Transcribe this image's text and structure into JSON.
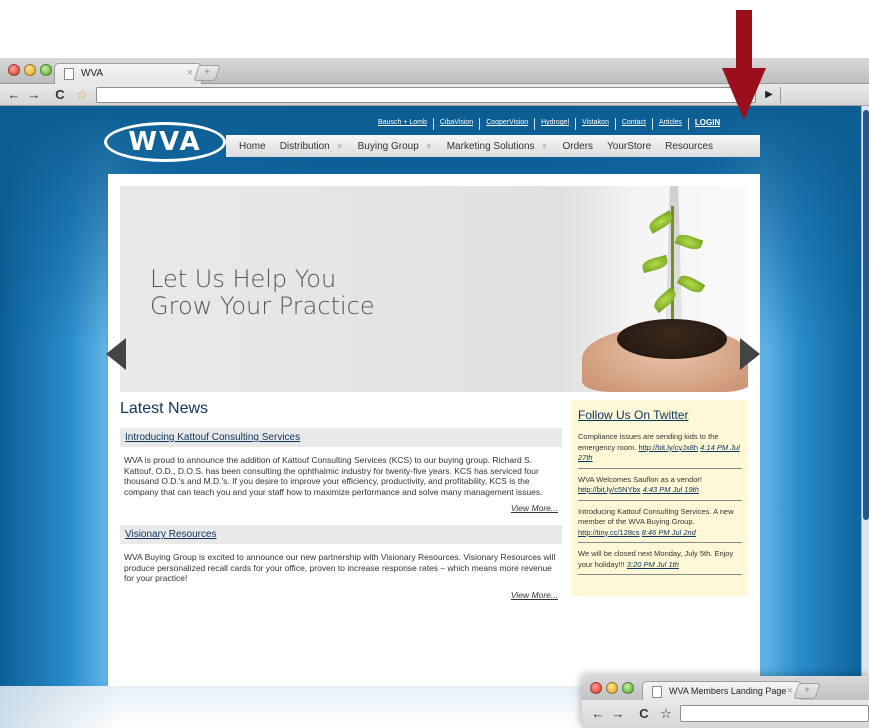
{
  "browser": {
    "tab_title": "WVA",
    "tab_close": "×",
    "new_tab": "+",
    "back": "←",
    "forward": "→",
    "reload": "C",
    "star": "☆",
    "play": "▶"
  },
  "site": {
    "logo_text": "WVA",
    "top_links": [
      "Bausch + Lomb",
      "CibaVision",
      "CooperVision",
      "Hydrogel",
      "Vistakon",
      "Contact",
      "Articles",
      "LOGIN"
    ],
    "nav": [
      {
        "label": "Home",
        "caret": ""
      },
      {
        "label": "Distribution",
        "caret": "▼"
      },
      {
        "label": "Buying Group",
        "caret": "▼"
      },
      {
        "label": "Marketing Solutions",
        "caret": "▼"
      },
      {
        "label": "Orders",
        "caret": ""
      },
      {
        "label": "YourStore",
        "caret": ""
      },
      {
        "label": "Resources",
        "caret": ""
      }
    ],
    "hero": {
      "line1": "Let Us Help You",
      "line2": "Grow Your Practice"
    },
    "news": {
      "heading": "Latest News",
      "articles": [
        {
          "title": "Introducing Kattouf Consulting Services",
          "body": "WVA is proud to announce the addition of Kattouf Consulting Services (KCS) to our buying group. Richard S. Kattouf, O.D., D.O.S. has been consulting the ophthalmic industry for twenty-five years. KCS has serviced four thousand O.D.'s and M.D.'s. If you desire to improve your efficiency, productivity, and profitability, KCS is the company that can teach you and your staff how to maximize performance and solve many management issues.",
          "more": "View More..."
        },
        {
          "title": "Visionary Resources",
          "body": "WVA Buying Group is excited to announce our new partnership with Visionary Resources. Visionary Resources will produce personalized recall cards for your office, proven to increase response rates – which means more revenue for your practice!",
          "more": "View More..."
        }
      ]
    },
    "twitter": {
      "heading": "Follow Us On Twitter",
      "tweets": [
        {
          "text": "Compliance issues are sending kids to the emergency room.",
          "link": "http://bit.ly/cyJx8h",
          "time": "4:14 PM Jul 27th"
        },
        {
          "text": "WVA Welcomes Sauflon as a vendor!",
          "link": "http://bit.ly/c5NYbx",
          "time": "4:43 PM Jul 19th"
        },
        {
          "text": "Introducing Kattouf Consulting Services. A new member of the WVA Buying Group.",
          "link": "http://tiny.cc/128cs",
          "time": "8:46 PM Jul 2nd"
        },
        {
          "text": "We will be closed next Monday, July 5th. Enjoy your holiday!!!",
          "link": "",
          "time": "3:20 PM Jul 1th"
        }
      ]
    }
  },
  "window2": {
    "tab_title": "WVA Members Landing Page",
    "tab_close": "×",
    "new_tab": "+",
    "back": "←",
    "forward": "→",
    "reload": "C",
    "star": "☆"
  },
  "colors": {
    "annotation_arrow": "#9b0f1d",
    "site_blue": "#0f69a6",
    "twitter_bg": "#fff8d6"
  }
}
